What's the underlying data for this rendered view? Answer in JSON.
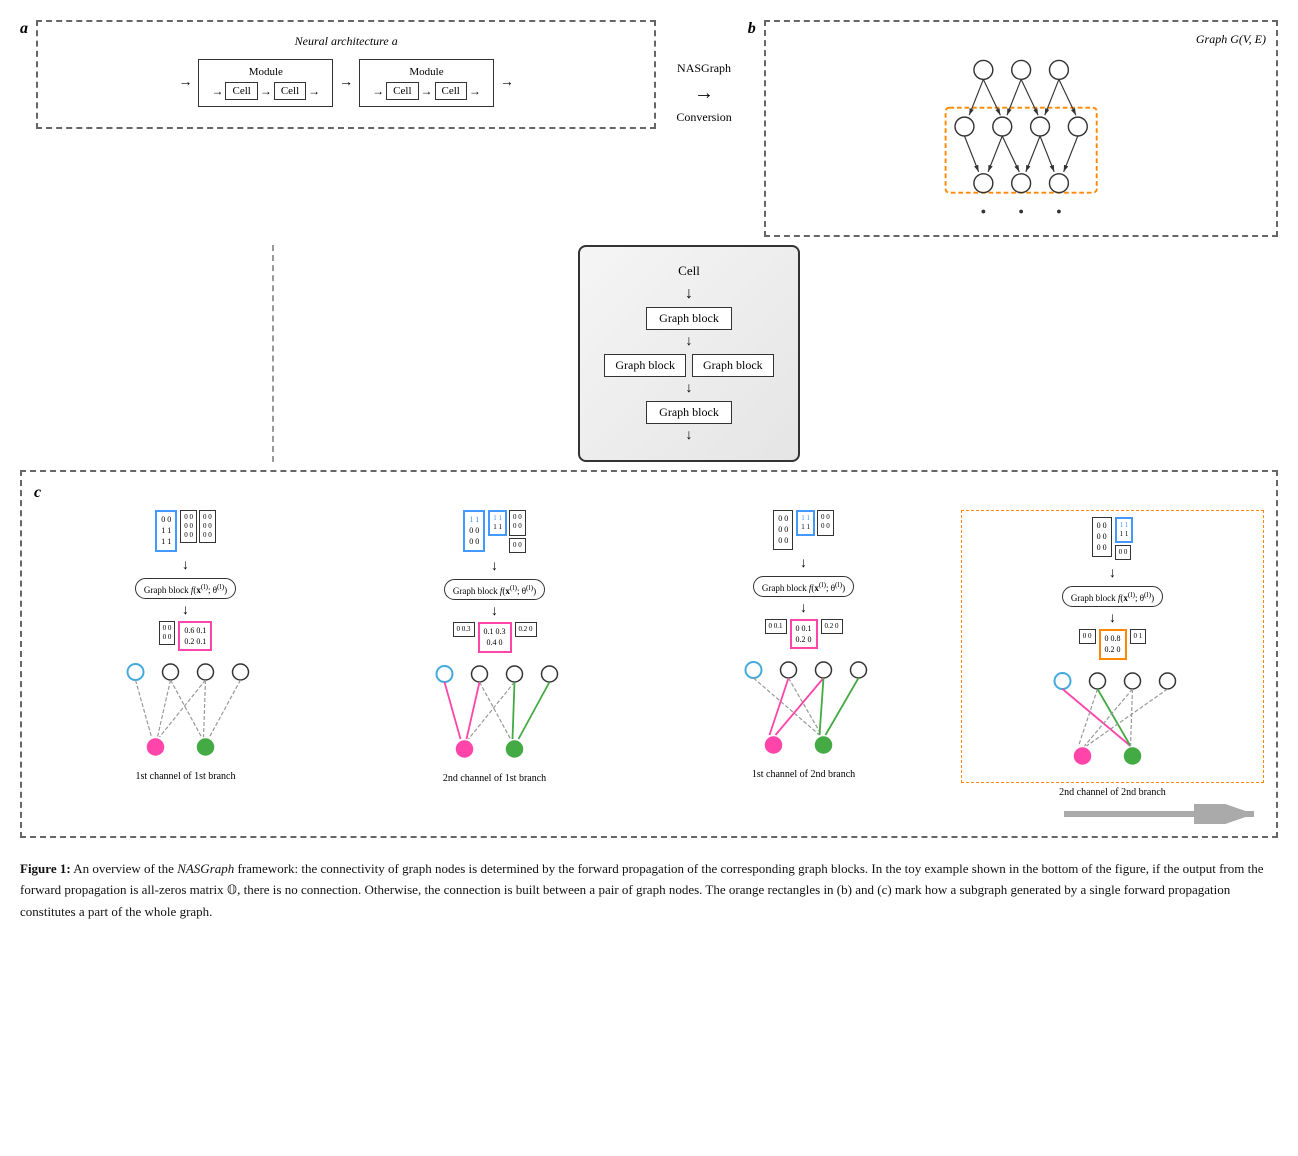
{
  "labels": {
    "panel_a": "a",
    "panel_b": "b",
    "panel_c": "c",
    "neural_arch": "Neural architecture",
    "neural_arch_italic": "a",
    "module": "Module",
    "cell": "Cell",
    "nasgraph": "NASGraph",
    "conversion": "Conversion",
    "graph_gve": "Graph G(V, E)",
    "graph_block": "Graph block",
    "graph_block_func": "Graph block f(x(l); θ(l))",
    "1st_channel_1st": "1st channel of 1st branch",
    "2nd_channel_1st": "2nd channel of 1st branch",
    "1st_channel_2nd": "1st channel of 2nd branch",
    "2nd_channel_2nd": "2nd channel of 2nd branch"
  },
  "caption": {
    "title": "Figure 1:",
    "text": " An overview of the NASGraph framework: the connectivity of graph nodes is determined by the forward propagation of the corresponding graph blocks. In the toy example shown in the bottom of the figure, if the output from the forward propagation is all-zeros matrix 𝕆, there is no connection. Otherwise, the connection is built between a pair of graph nodes. The orange rectangles in (b) and (c) mark how a subgraph generated by a single forward propagation constitutes a part of the whole graph."
  },
  "colors": {
    "blue": "#4499ff",
    "pink": "#ff44aa",
    "orange": "#ff8800",
    "green": "#44aa44",
    "dashed_border": "#666"
  }
}
